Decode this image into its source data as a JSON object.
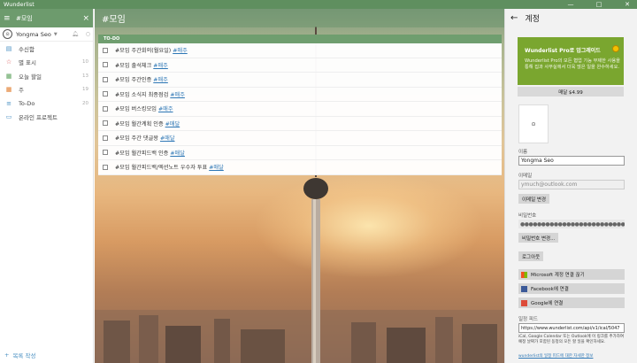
{
  "window": {
    "title": "Wunderlist",
    "min": "—",
    "max": "□",
    "close": "✕"
  },
  "sidebar": {
    "search_value": "#모임",
    "user_name": "Yongma Seo",
    "items": [
      {
        "icon": "inbox-icon",
        "glyph": "▤",
        "color": "#4a90c2",
        "label": "수신함",
        "count": ""
      },
      {
        "icon": "star-icon",
        "glyph": "☆",
        "color": "#d94b4b",
        "label": "별 표시",
        "count": "10"
      },
      {
        "icon": "calendar-icon",
        "glyph": "▦",
        "color": "#5aa15a",
        "label": "오늘 할일",
        "count": "13"
      },
      {
        "icon": "week-icon",
        "glyph": "▦",
        "color": "#e07b2a",
        "label": "주",
        "count": "19"
      },
      {
        "icon": "list-icon",
        "glyph": "≡",
        "color": "#4a90c2",
        "label": "To-Do",
        "count": "20"
      },
      {
        "icon": "folder-icon",
        "glyph": "▭",
        "color": "#4a90c2",
        "label": "온라인 프로젝트",
        "count": ""
      }
    ],
    "add_list": "목록 작성"
  },
  "main": {
    "title": "#모임",
    "section": "TO-DO",
    "tasks": [
      {
        "text": "#모임 주간회의(월요일) ",
        "tag": "#매주"
      },
      {
        "text": "#모임 출석체크 ",
        "tag": "#매주"
      },
      {
        "text": "#모임 주간인증 ",
        "tag": "#매주"
      },
      {
        "text": "#모임 소식지 최종점검 ",
        "tag": "#매주"
      },
      {
        "text": "#모임 버스킹모임 ",
        "tag": "#매주"
      },
      {
        "text": "#모임 월간계획 인증 ",
        "tag": "#매달"
      },
      {
        "text": "#모임 주간 댓글왕 ",
        "tag": "#매달"
      },
      {
        "text": "#모임 월간피드백 인증 ",
        "tag": "#매달"
      },
      {
        "text": "#모임 월간피드백/엑션노트 우수자 투표 ",
        "tag": "#매달"
      }
    ]
  },
  "account": {
    "title": "계정",
    "pro_title": "Wunderlist Pro로 업그레이드",
    "pro_desc": "Wunderlist Pro의 모든 협업 기능 무제한 사용을 통해 집과 사무실에서 더욱 많은 일을 완수하세요.",
    "buy_label": "매달 $4.99",
    "avatar_text": "⊙",
    "name_label": "이름",
    "name_value": "Yongma Seo",
    "email_label": "이메일",
    "email_value": "ymuch@outlook.com",
    "email_change": "이메일 변경",
    "pw_label": "비밀번호",
    "pw_value": "●●●●●●●●●●●●●●●●●●●●●●●●●●●",
    "pw_change": "비밀번호 변경...",
    "logout": "로그아웃",
    "ms_link": "Microsoft 계정 연결 끊기",
    "fb_link": "Facebook에 연결",
    "google_link": "Google에 연결",
    "cal_label": "일정 피드",
    "cal_value": "https://www.wunderlist.com/api/v1/ical/5047",
    "cal_note": "iCal, Google Calendar 또는 Outlook에 이 링크를 추가하여 예정 날짜가 포함된 동정의 모든 할 일을 확인하세요.",
    "cal_more": "wunderlist의 일정 피드에 대한 자세한 정보"
  }
}
